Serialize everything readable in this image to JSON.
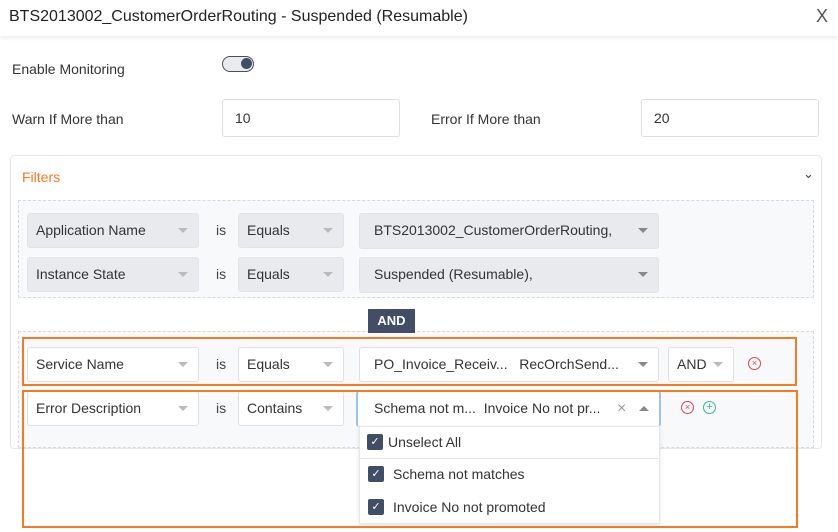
{
  "dialog": {
    "title": "BTS2013002_CustomerOrderRouting - Suspended (Resumable)",
    "close_label": "X"
  },
  "monitoring": {
    "label": "Enable Monitoring",
    "enabled": true
  },
  "thresholds": {
    "warn_label": "Warn If More than",
    "warn_value": "10",
    "error_label": "Error If More than",
    "error_value": "20"
  },
  "filters": {
    "title": "Filters",
    "fixed_rows": [
      {
        "field": "Application Name",
        "is": "is",
        "operator": "Equals",
        "value": "BTS2013002_CustomerOrderRouting,"
      },
      {
        "field": "Instance State",
        "is": "is",
        "operator": "Equals",
        "value": "Suspended (Resumable),"
      }
    ],
    "group_joiner": "AND",
    "rows": [
      {
        "field": "Service Name",
        "is": "is",
        "operator": "Equals",
        "value_1": "PO_Invoice_Receiv...",
        "value_2": "RecOrchSend...",
        "joiner": "AND"
      },
      {
        "field": "Error Description",
        "is": "is",
        "operator": "Contains",
        "value_1": "Schema not m...",
        "value_2": "Invoice No not pr...",
        "clear": "×"
      }
    ],
    "dropdown": {
      "select_all": "Unselect All",
      "options": [
        {
          "label": "Schema not matches",
          "checked": true
        },
        {
          "label": "Invoice No not promoted",
          "checked": true
        }
      ]
    }
  },
  "colors": {
    "accent": "#f37b21",
    "primary": "#424d66",
    "remove": "#e0424f",
    "add": "#2ebd85"
  }
}
